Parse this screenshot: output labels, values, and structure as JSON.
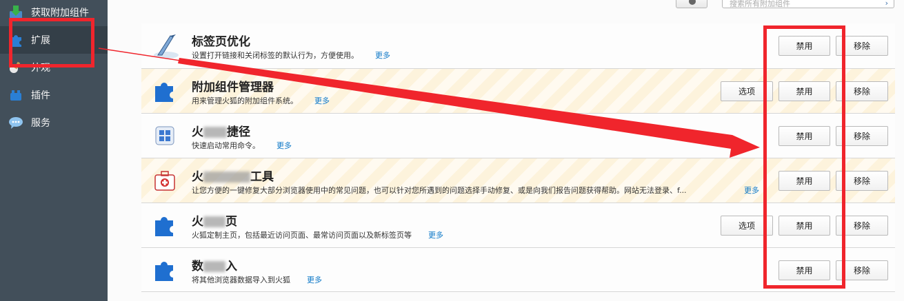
{
  "sidebar": {
    "items": [
      {
        "label": "获取附加组件",
        "icon": "download-addon-icon"
      },
      {
        "label": "扩展",
        "icon": "puzzle-icon",
        "active": true
      },
      {
        "label": "外观",
        "icon": "brush-icon"
      },
      {
        "label": "插件",
        "icon": "lego-block-icon"
      },
      {
        "label": "服务",
        "icon": "chat-bubble-icon"
      }
    ]
  },
  "toolbar": {
    "search_placeholder": "搜索所有附加组件",
    "search_go": "›"
  },
  "extensions": [
    {
      "name": "标签页优化",
      "desc": "设置打开链接和关闭标签的默认行为，方便使用。",
      "more": "更多",
      "options": null,
      "disable": "禁用",
      "remove": "移除",
      "icon": "quill-pen-icon"
    },
    {
      "name": "附加组件管理器",
      "desc": "用来管理火狐的附加组件系统。",
      "more": "更多",
      "options": "选项",
      "disable": "禁用",
      "remove": "移除",
      "icon": "puzzle-icon"
    },
    {
      "name_a": "火",
      "name_b": "捷径",
      "desc": "快速启动常用命令。",
      "more": "更多",
      "options": null,
      "disable": "禁用",
      "remove": "移除",
      "icon": "window-logo-icon"
    },
    {
      "name_a": "火",
      "name_b": "工具",
      "desc": "让您方便的一键修复大部分浏览器使用中的常见问题，也可以针对您所遇到的问题选择手动修复、或是向我们报告问题获得帮助。网站无法登录、f...",
      "more": "更多",
      "options": null,
      "disable": "禁用",
      "remove": "移除",
      "icon": "first-aid-kit-icon"
    },
    {
      "name_a": "火",
      "name_b": "页",
      "desc": "火狐定制主页，包括最近访问页面、最常访问页面以及新标签页等",
      "more": "更多",
      "options": "选项",
      "disable": "禁用",
      "remove": "移除",
      "icon": "puzzle-icon"
    },
    {
      "name_a": "数",
      "name_b": "入",
      "desc": "将其他浏览器数据导入到火狐",
      "more": "更多",
      "options": null,
      "disable": "禁用",
      "remove": "移除",
      "icon": "puzzle-icon"
    }
  ],
  "annotation": {
    "color": "#f0252c"
  }
}
